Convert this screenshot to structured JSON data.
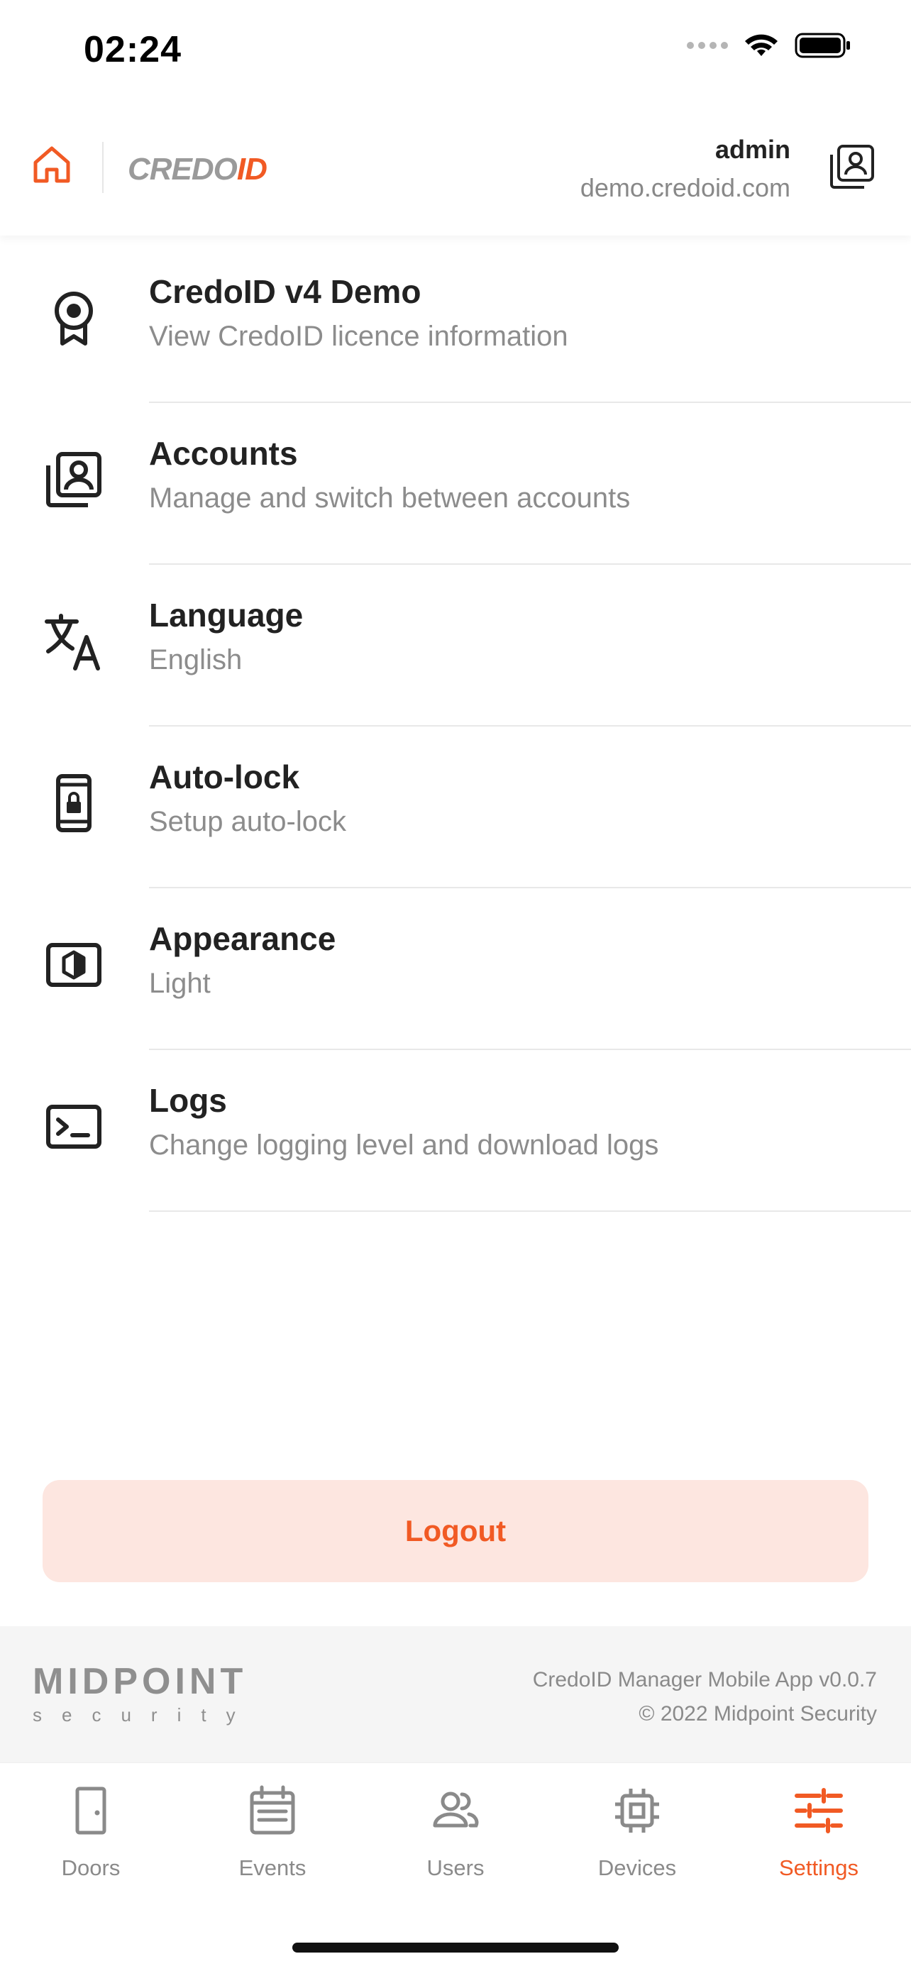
{
  "status": {
    "time": "02:24"
  },
  "header": {
    "brand_prefix": "CREDO",
    "brand_suffix": "ID",
    "account_name": "admin",
    "account_domain": "demo.credoid.com"
  },
  "settings": [
    {
      "title": "CredoID v4 Demo",
      "subtitle": "View CredoID licence information",
      "icon": "badge-icon"
    },
    {
      "title": "Accounts",
      "subtitle": "Manage and switch between accounts",
      "icon": "accounts-icon"
    },
    {
      "title": "Language",
      "subtitle": "English",
      "icon": "translate-icon"
    },
    {
      "title": "Auto-lock",
      "subtitle": "Setup auto-lock",
      "icon": "phone-lock-icon"
    },
    {
      "title": "Appearance",
      "subtitle": "Light",
      "icon": "contrast-icon"
    },
    {
      "title": "Logs",
      "subtitle": "Change logging level and download logs",
      "icon": "terminal-icon"
    }
  ],
  "logout_label": "Logout",
  "footer": {
    "company_word": "MIDPOINT",
    "company_sub": "security",
    "app_version": "CredoID Manager Mobile App v0.0.7",
    "copyright": "© 2022 Midpoint Security"
  },
  "tabs": [
    {
      "label": "Doors",
      "icon": "door-icon"
    },
    {
      "label": "Events",
      "icon": "events-icon"
    },
    {
      "label": "Users",
      "icon": "users-icon"
    },
    {
      "label": "Devices",
      "icon": "chip-icon"
    },
    {
      "label": "Settings",
      "icon": "sliders-icon",
      "active": true
    }
  ],
  "colors": {
    "accent": "#f15a24",
    "accent_soft": "#fde6e0",
    "muted": "#8a8a8a"
  }
}
